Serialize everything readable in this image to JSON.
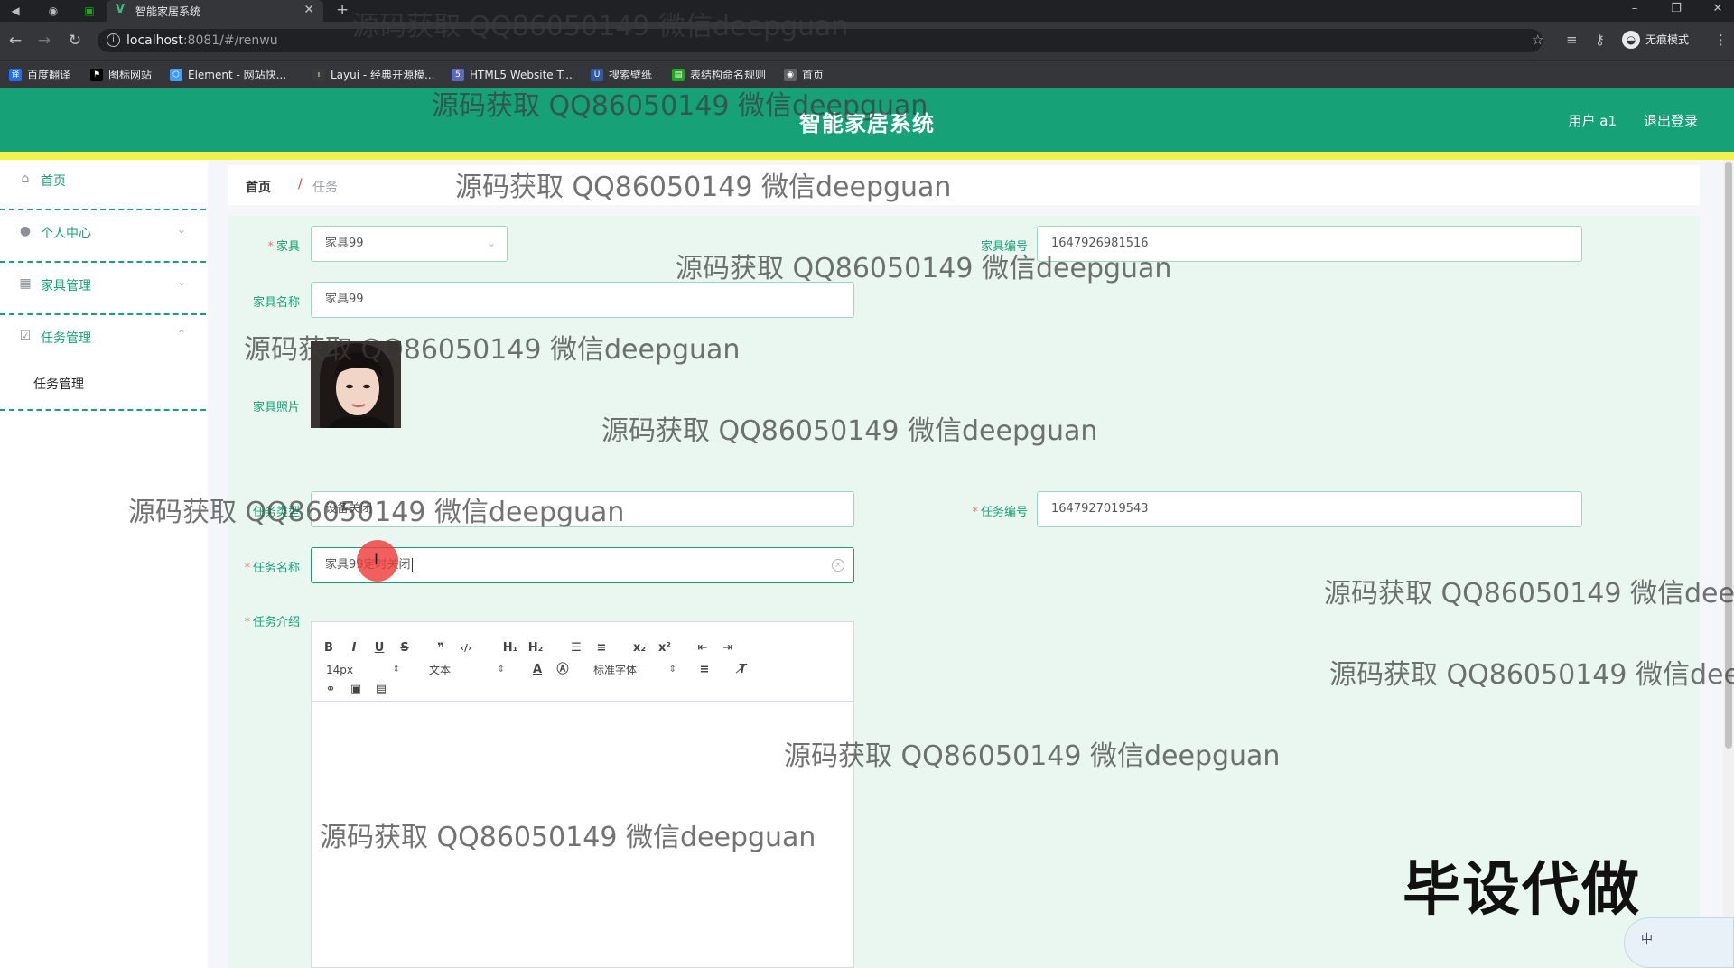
{
  "browser": {
    "tab_title": "智能家居系统",
    "url_host": "localhost",
    "url_rest": ":8081/#/renwu",
    "incognito_label": "无痕模式",
    "bookmarks": [
      {
        "label": "百度翻译",
        "color": "#1e6ff5"
      },
      {
        "label": "图标网站",
        "color": "#000000"
      },
      {
        "label": "Element - 网站快...",
        "color": "#409eff"
      },
      {
        "label": "Layui - 经典开源模...",
        "color": "#3a3a3a"
      },
      {
        "label": "HTML5 Website T...",
        "color": "#5c6bc0"
      },
      {
        "label": "搜索壁纸",
        "color": "#2f5aa8"
      },
      {
        "label": "表结构命名规则",
        "color": "#1aad19"
      },
      {
        "label": "首页",
        "color": "#5f6368"
      }
    ]
  },
  "header": {
    "title": "智能家居系统",
    "user": "用户 a1",
    "logout": "退出登录",
    "brand_color": "#16a276",
    "strip_color": "#f2f04a"
  },
  "sidebar": {
    "items": [
      {
        "label": "首页",
        "icon": "home-icon"
      },
      {
        "label": "个人中心",
        "icon": "user-icon"
      },
      {
        "label": "家具管理",
        "icon": "grid-icon"
      },
      {
        "label": "任务管理",
        "icon": "checkbox-icon"
      }
    ],
    "sub_items": [
      {
        "label": "任务管理"
      }
    ]
  },
  "breadcrumb": {
    "home": "首页",
    "separator": "/",
    "current": "任务"
  },
  "form": {
    "furniture_label": "家具",
    "furniture_value": "家具99",
    "furniture_no_label": "家具编号",
    "furniture_no_value": "1647926981516",
    "furniture_name_label": "家具名称",
    "furniture_name_value": "家具99",
    "furniture_photo_label": "家具照片",
    "task_type_label": "任务类型",
    "task_type_value": "设备关闭",
    "task_no_label": "任务编号",
    "task_no_value": "1647927019543",
    "task_name_label": "任务名称",
    "task_name_value": "家具99定时关闭",
    "task_intro_label": "任务介绍"
  },
  "editor": {
    "font_size": "14px",
    "header_select": "文本",
    "font_family": "标准字体"
  },
  "watermark": "源码获取 QQ86050149 微信deepguan",
  "promo": "毕设代做",
  "ime": "中"
}
